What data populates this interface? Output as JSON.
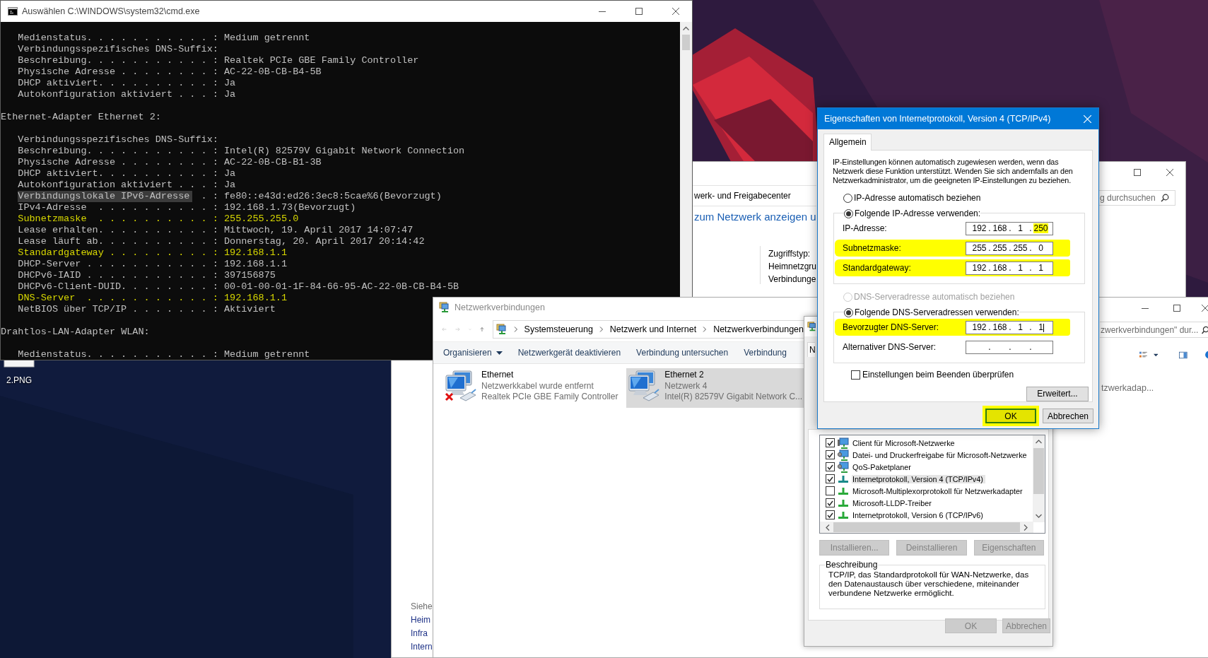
{
  "desktop": {
    "icons": [
      {
        "label": "2.PNG"
      }
    ]
  },
  "sharing_center": {
    "breadcrumb_tail": "werk- und Freigabecenter",
    "search_placeholder": "g durchsuchen",
    "heading": "zum Netzwerk anzeigen u",
    "info_labels": [
      "Zugriffstyp:",
      "Heimnetzgru",
      "Verbindunge"
    ],
    "see_also": {
      "heading": "Siehe",
      "links": [
        "Heim",
        "Infra",
        "Intern"
      ]
    }
  },
  "console": {
    "title": "Auswählen C:\\WINDOWS\\system32\\cmd.exe",
    "lines": [
      {
        "kind": "field",
        "text": "Medienstatus. . . . . . . . . . . : Medium getrennt",
        "highlighted": false,
        "selected": false
      },
      {
        "kind": "field",
        "text": "Verbindungsspezifisches DNS-Suffix:",
        "highlighted": false,
        "selected": false
      },
      {
        "kind": "field",
        "text": "Beschreibung. . . . . . . . . . . : Realtek PCIe GBE Family Controller",
        "highlighted": false,
        "selected": false
      },
      {
        "kind": "field",
        "text": "Physische Adresse . . . . . . . . : AC-22-0B-CB-B4-5B",
        "highlighted": false,
        "selected": false
      },
      {
        "kind": "field",
        "text": "DHCP aktiviert. . . . . . . . . . : Ja",
        "highlighted": false,
        "selected": false
      },
      {
        "kind": "field",
        "text": "Autokonfiguration aktiviert . . . : Ja",
        "highlighted": false,
        "selected": false
      },
      {
        "kind": "header",
        "text": "Ethernet-Adapter Ethernet 2:",
        "highlighted": false,
        "selected": false
      },
      {
        "kind": "field",
        "text": "Verbindungsspezifisches DNS-Suffix:",
        "highlighted": false,
        "selected": false
      },
      {
        "kind": "field",
        "text": "Beschreibung. . . . . . . . . . . : Intel(R) 82579V Gigabit Network Connection",
        "highlighted": false,
        "selected": false
      },
      {
        "kind": "field",
        "text": "Physische Adresse . . . . . . . . : AC-22-0B-CB-B1-3B",
        "highlighted": false,
        "selected": false
      },
      {
        "kind": "field",
        "text": "DHCP aktiviert. . . . . . . . . . : Ja",
        "highlighted": false,
        "selected": false
      },
      {
        "kind": "field",
        "text": "Autokonfiguration aktiviert . . . : Ja",
        "highlighted": false,
        "selected": false
      },
      {
        "kind": "field",
        "text": "Verbindungslokale IPv6-Adresse  . : fe80::e43d:ed26:3ec8:5cae%6(Bevorzugt)",
        "highlighted": false,
        "selected": true
      },
      {
        "kind": "field",
        "text": "IPv4-Adresse  . . . . . . . . . . : 192.168.1.73(Bevorzugt)",
        "highlighted": false,
        "selected": false
      },
      {
        "kind": "field",
        "text": "Subnetzmaske  . . . . . . . . . . : 255.255.255.0",
        "highlighted": true,
        "selected": false
      },
      {
        "kind": "field",
        "text": "Lease erhalten. . . . . . . . . . : Mittwoch, 19. April 2017 14:07:47",
        "highlighted": false,
        "selected": false
      },
      {
        "kind": "field",
        "text": "Lease läuft ab. . . . . . . . . . : Donnerstag, 20. April 2017 20:14:42",
        "highlighted": false,
        "selected": false
      },
      {
        "kind": "field",
        "text": "Standardgateway . . . . . . . . . : 192.168.1.1",
        "highlighted": true,
        "selected": false
      },
      {
        "kind": "field",
        "text": "DHCP-Server . . . . . . . . . . . : 192.168.1.1",
        "highlighted": false,
        "selected": false
      },
      {
        "kind": "field",
        "text": "DHCPv6-IAID . . . . . . . . . . . : 397156875",
        "highlighted": false,
        "selected": false
      },
      {
        "kind": "field",
        "text": "DHCPv6-Client-DUID. . . . . . . . : 00-01-00-01-1F-84-66-95-AC-22-0B-CB-B4-5B",
        "highlighted": false,
        "selected": false
      },
      {
        "kind": "field",
        "text": "DNS-Server  . . . . . . . . . . . : 192.168.1.1",
        "highlighted": true,
        "selected": false
      },
      {
        "kind": "field",
        "text": "NetBIOS über TCP/IP . . . . . . . : Aktiviert",
        "highlighted": false,
        "selected": false
      },
      {
        "kind": "header",
        "text": "Drahtlos-LAN-Adapter WLAN:",
        "highlighted": false,
        "selected": false
      },
      {
        "kind": "field",
        "text": "Medienstatus. . . . . . . . . . . : Medium getrennt",
        "highlighted": false,
        "selected": false
      }
    ]
  },
  "connections_window": {
    "title": "Netzwerkverbindungen",
    "breadcrumb": [
      "Systemsteuerung",
      "Netzwerk und Internet",
      "Netzwerkverbindungen"
    ],
    "search_placeholder": "zwerkverbindungen\" dur...",
    "toolbar": [
      {
        "label": "Organisieren",
        "dropdown": true
      },
      {
        "label": "Netzwerkgerät deaktivieren",
        "dropdown": false
      },
      {
        "label": "Verbindung untersuchen",
        "dropdown": false
      },
      {
        "label": "Verbindung",
        "dropdown": false
      }
    ],
    "adapters": [
      {
        "name": "Ethernet",
        "status": "Netzwerkkabel wurde entfernt",
        "device": "Realtek PCIe GBE Family Controller",
        "disconnected": true,
        "selected": false
      },
      {
        "name": "Ethernet 2",
        "status": "Netzwerk 4",
        "device": "Intel(R) 82579V Gigabit Network C...",
        "disconnected": false,
        "selected": true
      }
    ],
    "cut_item_text": "tzwerkadap..."
  },
  "adapter_properties": {
    "tab_fragment": "N",
    "components": [
      {
        "kind": "client",
        "label": "Client für Microsoft-Netzwerke",
        "checked": true,
        "selected": false
      },
      {
        "kind": "service",
        "label": "Datei- und Druckerfreigabe für Microsoft-Netzwerke",
        "checked": true,
        "selected": false
      },
      {
        "kind": "service",
        "label": "QoS-Paketplaner",
        "checked": true,
        "selected": false
      },
      {
        "kind": "protocol",
        "label": "Internetprotokoll, Version 4 (TCP/IPv4)",
        "checked": true,
        "selected": true
      },
      {
        "kind": "protocol",
        "label": "Microsoft-Multiplexorprotokoll für Netzwerkadapter",
        "checked": false,
        "selected": false
      },
      {
        "kind": "protocol",
        "label": "Microsoft-LLDP-Treiber",
        "checked": true,
        "selected": false
      },
      {
        "kind": "protocol",
        "label": "Internetprotokoll, Version 6 (TCP/IPv6)",
        "checked": true,
        "selected": false
      }
    ],
    "buttons": [
      {
        "label": "Installieren...",
        "disabled": true
      },
      {
        "label": "Deinstallieren",
        "disabled": true
      },
      {
        "label": "Eigenschaften",
        "disabled": true
      }
    ],
    "description_title": "Beschreibung",
    "description": "TCP/IP, das Standardprotokoll für WAN-Netzwerke, das den Datenaustausch über verschiedene, miteinander verbundene Netzwerke ermöglicht.",
    "dialog_buttons": [
      {
        "label": "OK",
        "disabled": true
      },
      {
        "label": "Abbrechen",
        "disabled": true
      }
    ]
  },
  "ipv4_dialog": {
    "title": "Eigenschaften von Internetprotokoll, Version 4 (TCP/IPv4)",
    "tabs": [
      {
        "label": "Allgemein",
        "selected": true
      }
    ],
    "intro": "IP-Einstellungen können automatisch zugewiesen werden, wenn das Netzwerk diese Funktion unterstützt. Wenden Sie sich andernfalls an den Netzwerkadministrator, um die geeigneten IP-Einstellungen zu beziehen.",
    "octet_separator": ".",
    "ip_auto": {
      "label": "IP-Adresse automatisch beziehen",
      "selected": false,
      "disabled": false
    },
    "ip_manual": {
      "label": "Folgende IP-Adresse verwenden:",
      "selected": true,
      "disabled": false,
      "fields": [
        {
          "label": "IP-Adresse:",
          "highlighted": false,
          "focused": false,
          "octets": [
            {
              "value": "192",
              "highlighted": false
            },
            {
              "value": "168",
              "highlighted": false
            },
            {
              "value": "1",
              "highlighted": false
            },
            {
              "value": "250",
              "highlighted": true
            }
          ]
        },
        {
          "label": "Subnetzmaske:",
          "highlighted": true,
          "focused": false,
          "octets": [
            {
              "value": "255",
              "highlighted": false
            },
            {
              "value": "255",
              "highlighted": false
            },
            {
              "value": "255",
              "highlighted": false
            },
            {
              "value": "0",
              "highlighted": false
            }
          ]
        },
        {
          "label": "Standardgateway:",
          "highlighted": true,
          "focused": false,
          "octets": [
            {
              "value": "192",
              "highlighted": false
            },
            {
              "value": "168",
              "highlighted": false
            },
            {
              "value": "1",
              "highlighted": false
            },
            {
              "value": "1",
              "highlighted": false
            }
          ]
        }
      ]
    },
    "dns_auto": {
      "label": "DNS-Serveradresse automatisch beziehen",
      "selected": false,
      "disabled": true
    },
    "dns_manual": {
      "label": "Folgende DNS-Serveradressen verwenden:",
      "selected": true,
      "disabled": false,
      "fields": [
        {
          "label": "Bevorzugter DNS-Server:",
          "highlighted": true,
          "focused": true,
          "octets": [
            {
              "value": "192",
              "highlighted": false
            },
            {
              "value": "168",
              "highlighted": false
            },
            {
              "value": "1",
              "highlighted": false
            },
            {
              "value": "1",
              "highlighted": false
            }
          ]
        },
        {
          "label": "Alternativer DNS-Server:",
          "highlighted": false,
          "focused": false
        }
      ]
    },
    "validate": {
      "label": "Einstellungen beim Beenden überprüfen",
      "checked": false
    },
    "advanced_button": "Erweitert...",
    "buttons": [
      {
        "label": "OK",
        "highlighted": true
      },
      {
        "label": "Abbrechen",
        "highlighted": false
      }
    ]
  }
}
